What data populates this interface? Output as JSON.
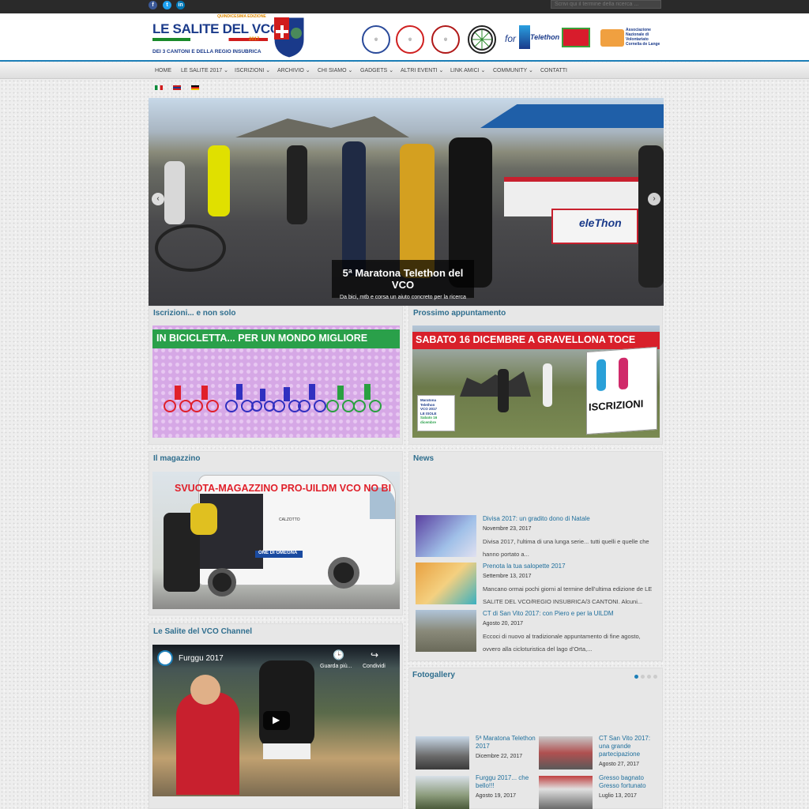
{
  "search": {
    "placeholder": "Scrivi qui il termine della ricerca ..."
  },
  "brand": {
    "edition": "QUINDICESIMA EDIZIONE",
    "title": "LE SALITE DEL VCO",
    "year": "2017",
    "subtitle": "DEI 3 CANTONI E DELLA REGIO INSUBRICA"
  },
  "partners": {
    "for_label": "for",
    "telethon": "Telethon",
    "assoc": "Associazione Nazionale di Volontariato Cornelia de Lange"
  },
  "nav": [
    {
      "label": "HOME"
    },
    {
      "label": "LE SALITE 2017"
    },
    {
      "label": "ISCRIZIONI"
    },
    {
      "label": "ARCHIVIO"
    },
    {
      "label": "CHI SIAMO"
    },
    {
      "label": "GADGETS"
    },
    {
      "label": "ALTRI EVENTI"
    },
    {
      "label": "LINK AMICI"
    },
    {
      "label": "COMMUNITY"
    },
    {
      "label": "CONTATTI"
    }
  ],
  "slider": {
    "caption_title": "5ª Maratona Telethon del VCO",
    "caption_sub": "Da bici, mtb e corsa un aiuto concreto per la ricerca",
    "banner_text": "eleThon"
  },
  "iscrizioni": {
    "title": "Iscrizioni... e non solo",
    "banner": "IN BICICLETTA... PER UN MONDO MIGLIORE"
  },
  "prossimo": {
    "title": "Prossimo appuntamento",
    "banner": "SABATO 16 DICEMBRE A GRAVELLONA TOCE",
    "sign": "ISCRIZIONI",
    "poster_lines": [
      "Maratona",
      "Telethon",
      "VCO 2017",
      "LE ISOLE",
      "Sabato 16 dicembre"
    ]
  },
  "magazzino": {
    "title": "Il magazzino",
    "banner": "SVUOTA-MAGAZZINO PRO-UILDM VCO NO BI",
    "van_text": "ONE DI OMEGNA",
    "van_brand": "CALZOTTO"
  },
  "news": {
    "title": "News",
    "items": [
      {
        "title": "Divisa 2017: un gradito dono di Natale",
        "date": "Novembre 23, 2017",
        "text": "Divisa 2017, l’ultima di una lunga serie... tutti quelli e quelle che hanno portato a..."
      },
      {
        "title": "Prenota la tua salopette 2017",
        "date": "Settembre 13, 2017",
        "text": "Mancano ormai pochi giorni al termine dell’ultima edizione de LE SALITE DEL VCO/REGIO INSUBRICA/3 CANTONI. Alcuni..."
      },
      {
        "title": "CT di San Vito 2017: con Piero e per la UILDM",
        "date": "Agosto 20, 2017",
        "text": "Eccoci di nuovo al tradizionale appuntamento di fine agosto, ovvero alla cicloturistica del lago d’Orta,..."
      }
    ]
  },
  "channel": {
    "title": "Le Salite del VCO Channel",
    "video_title": "Furggu 2017",
    "watch_later": "Guarda più...",
    "share": "Condividi"
  },
  "gallery": {
    "title": "Fotogallery",
    "items": [
      {
        "title": "5ª Maratona Telethon 2017",
        "date": "Dicembre 22, 2017"
      },
      {
        "title": "CT San Vito 2017: una grande partecipazione",
        "date": "Agosto 27, 2017"
      },
      {
        "title": "Furggu 2017... che bello!!!",
        "date": "Agosto 19, 2017"
      },
      {
        "title": "Gresso bagnato Gresso fortunato",
        "date": "Luglio 13, 2017"
      }
    ]
  },
  "colors": {
    "accent": "#1d7fb8",
    "title_blue": "#2f6e8e",
    "topbar": "#2a2a2a",
    "red": "#e02020",
    "green": "#2aa02a"
  }
}
